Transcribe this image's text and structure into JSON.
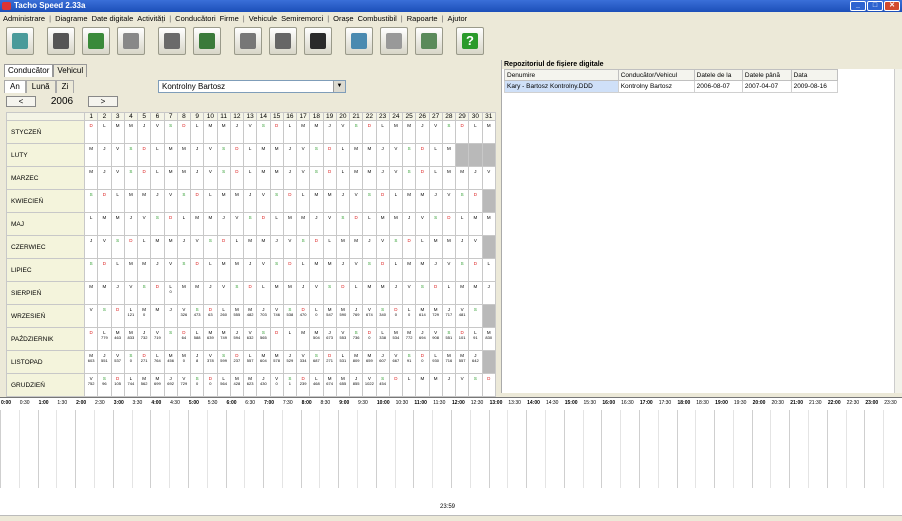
{
  "app": {
    "title": "Tacho Speed 2.33a"
  },
  "menu": [
    "Administrare",
    "Diagrame",
    "Date digitale",
    "Activități",
    "Conducători",
    "Firme",
    "Vehicule",
    "Semiremorci",
    "Orașe",
    "Combustibil",
    "Rapoarte",
    "Ajutor"
  ],
  "toolbar": [
    "disc-icon",
    "truck-card-icon",
    "card-reader-icon",
    "download-icon",
    "calculator-icon",
    "list-icon",
    "printer-icon",
    "printer2-icon",
    "speedometer-icon",
    "calendar-clock-icon",
    "disc-scan-icon",
    "report-icon",
    "help-icon"
  ],
  "toolbar_help_glyph": "?",
  "tabs": {
    "driver": "Conducător",
    "vehicle": "Vehicul"
  },
  "subtabs": {
    "year": "An",
    "month": "Lună",
    "day": "Zi"
  },
  "year_nav": {
    "prev": "<",
    "year": "2006",
    "next": ">"
  },
  "driver_select": {
    "value": "Kontrolny Bartosz"
  },
  "calendar": {
    "days": [
      "1",
      "2",
      "3",
      "4",
      "5",
      "6",
      "7",
      "8",
      "9",
      "10",
      "11",
      "12",
      "13",
      "14",
      "15",
      "16",
      "17",
      "18",
      "19",
      "20",
      "21",
      "22",
      "23",
      "24",
      "25",
      "26",
      "27",
      "28",
      "29",
      "30",
      "31"
    ],
    "months": [
      {
        "name": "STYCZEŃ",
        "start": 6,
        "len": 31,
        "vals": []
      },
      {
        "name": "LUTY",
        "start": 2,
        "len": 28,
        "vals": []
      },
      {
        "name": "MARZEC",
        "start": 2,
        "len": 31,
        "vals": []
      },
      {
        "name": "KWIECIEŃ",
        "start": 5,
        "len": 30,
        "vals": []
      },
      {
        "name": "MAJ",
        "start": 0,
        "len": 31,
        "vals": []
      },
      {
        "name": "CZERWIEC",
        "start": 3,
        "len": 30,
        "vals": []
      },
      {
        "name": "LIPIEC",
        "start": 5,
        "len": 31,
        "vals": []
      },
      {
        "name": "SIERPIEŃ",
        "start": 1,
        "len": 31,
        "vals": [
          "",
          "",
          "",
          "",
          "",
          "",
          "0",
          "",
          "",
          "",
          "",
          "",
          "",
          "",
          "",
          "",
          "",
          "",
          "",
          "",
          "",
          "",
          "",
          "",
          "",
          "",
          "",
          "",
          "",
          "",
          ""
        ]
      },
      {
        "name": "WRZESIEŃ",
        "start": 4,
        "len": 30,
        "vals": [
          "",
          "",
          "",
          "121",
          "0",
          "",
          "",
          "326",
          "473",
          "63",
          "260",
          "555",
          "482",
          "703",
          "746",
          "538",
          "470",
          "0",
          "547",
          "590",
          "769",
          "674",
          "340",
          "0",
          "0",
          "614",
          "729",
          "717",
          "481",
          "",
          ""
        ]
      },
      {
        "name": "PAŹDZIERNIK",
        "start": 6,
        "len": 31,
        "vals": [
          "",
          "779",
          "463",
          "833",
          "732",
          "719",
          "",
          "64",
          "588",
          "639",
          "749",
          "594",
          "632",
          "565",
          "",
          "",
          "",
          "504",
          "673",
          "553",
          "736",
          "0",
          "338",
          "534",
          "772",
          "694",
          "908",
          "551",
          "101",
          "91",
          "830",
          "701"
        ]
      },
      {
        "name": "LISTOPAD",
        "start": 2,
        "len": 30,
        "vals": [
          "603",
          "551",
          "537",
          "0",
          "271",
          "764",
          "456",
          "0",
          "8",
          "378",
          "599",
          "237",
          "557",
          "604",
          "578",
          "529",
          "334",
          "687",
          "271",
          "531",
          "809",
          "659",
          "607",
          "667",
          "91",
          "0",
          "930",
          "716",
          "557",
          "642",
          ""
        ]
      },
      {
        "name": "GRUDZIEŃ",
        "start": 4,
        "len": 31,
        "vals": [
          "752",
          "96",
          "105",
          "744",
          "562",
          "699",
          "692",
          "729",
          "0",
          "0",
          "564",
          "428",
          "623",
          "430",
          "0",
          "1",
          "239",
          "468",
          "674",
          "655",
          "855",
          "1022",
          "454",
          "",
          "",
          "",
          "",
          "",
          "",
          "",
          ""
        ]
      }
    ],
    "weekday_letters": [
      "L",
      "M",
      "M",
      "J",
      "V",
      "S",
      "D"
    ]
  },
  "repository": {
    "title": "Repozitoriul de fișiere digitale",
    "columns": [
      "Denumire",
      "Conducător/Vehicul",
      "Datele de la",
      "Datele până",
      "Data"
    ],
    "rows": [
      [
        "Kary - Bartosz Kontrolny.DDD",
        "Kontrolny Bartosz",
        "2006-08-07",
        "2007-04-07",
        "2009-08-16"
      ]
    ]
  },
  "timeline": {
    "labels": [
      "0:00",
      "0:30",
      "1:00",
      "1:30",
      "2:00",
      "2:30",
      "3:00",
      "3:30",
      "4:00",
      "4:30",
      "5:00",
      "5:30",
      "6:00",
      "6:30",
      "7:00",
      "7:30",
      "8:00",
      "8:30",
      "9:00",
      "9:30",
      "10:00",
      "10:30",
      "11:00",
      "11:30",
      "12:00",
      "12:30",
      "13:00",
      "13:30",
      "14:00",
      "14:30",
      "15:00",
      "15:30",
      "16:00",
      "16:30",
      "17:00",
      "17:30",
      "18:00",
      "18:30",
      "19:00",
      "19:30",
      "20:00",
      "20:30",
      "21:00",
      "21:30",
      "22:00",
      "22:30",
      "23:00",
      "23:30"
    ],
    "current_time": "23:59"
  }
}
